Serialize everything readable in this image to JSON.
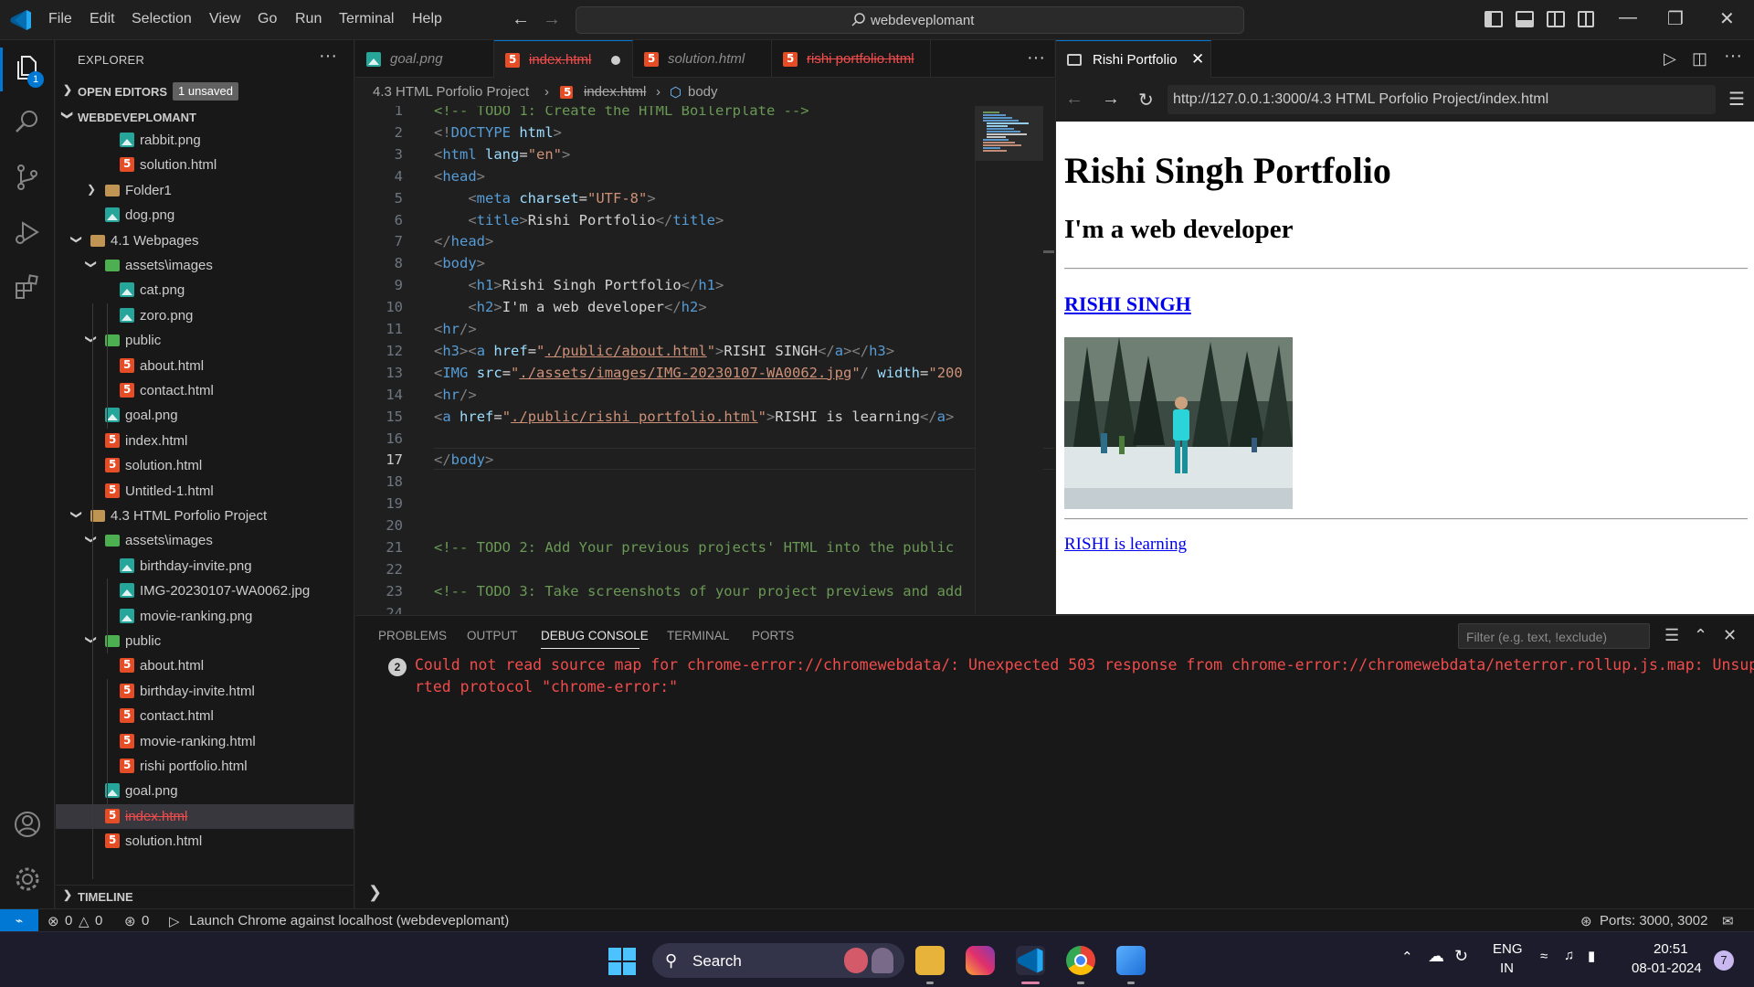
{
  "titlebar": {
    "menu": [
      "File",
      "Edit",
      "Selection",
      "View",
      "Go",
      "Run",
      "Terminal",
      "Help"
    ],
    "command_center": "webdeveplomant"
  },
  "activity_badge": "1",
  "sidebar": {
    "title": "EXPLORER",
    "open_editors": "OPEN EDITORS",
    "unsaved": "1 unsaved",
    "workspace": "WEBDEVEPLOMANT",
    "timeline": "TIMELINE",
    "tree": [
      {
        "name": "rabbit.png",
        "type": "img",
        "indent": 2
      },
      {
        "name": "solution.html",
        "type": "html",
        "indent": 2
      },
      {
        "name": "Folder1",
        "type": "folder",
        "indent": 1,
        "chevron": "right"
      },
      {
        "name": "dog.png",
        "type": "img",
        "indent": 1
      },
      {
        "name": "4.1 Webpages",
        "type": "folder",
        "indent": 0,
        "chevron": "down"
      },
      {
        "name": "assets\\images",
        "type": "folder-green",
        "indent": 1,
        "chevron": "down"
      },
      {
        "name": "cat.png",
        "type": "img",
        "indent": 2
      },
      {
        "name": "zoro.png",
        "type": "img",
        "indent": 2
      },
      {
        "name": "public",
        "type": "folder-green",
        "indent": 1,
        "chevron": "down"
      },
      {
        "name": "about.html",
        "type": "html",
        "indent": 2
      },
      {
        "name": "contact.html",
        "type": "html",
        "indent": 2
      },
      {
        "name": "goal.png",
        "type": "img",
        "indent": 1
      },
      {
        "name": "index.html",
        "type": "html",
        "indent": 1
      },
      {
        "name": "solution.html",
        "type": "html",
        "indent": 1
      },
      {
        "name": "Untitled-1.html",
        "type": "html",
        "indent": 1
      },
      {
        "name": "4.3 HTML Porfolio Project",
        "type": "folder",
        "indent": 0,
        "chevron": "down"
      },
      {
        "name": "assets\\images",
        "type": "folder-green",
        "indent": 1,
        "chevron": "down"
      },
      {
        "name": "birthday-invite.png",
        "type": "img",
        "indent": 2
      },
      {
        "name": "IMG-20230107-WA0062.jpg",
        "type": "img",
        "indent": 2
      },
      {
        "name": "movie-ranking.png",
        "type": "img",
        "indent": 2
      },
      {
        "name": "public",
        "type": "folder-green",
        "indent": 1,
        "chevron": "down"
      },
      {
        "name": "about.html",
        "type": "html",
        "indent": 2
      },
      {
        "name": "birthday-invite.html",
        "type": "html",
        "indent": 2
      },
      {
        "name": "contact.html",
        "type": "html",
        "indent": 2
      },
      {
        "name": "movie-ranking.html",
        "type": "html",
        "indent": 2
      },
      {
        "name": "rishi portfolio.html",
        "type": "html",
        "indent": 2
      },
      {
        "name": "goal.png",
        "type": "img",
        "indent": 1
      },
      {
        "name": "index.html",
        "type": "html",
        "indent": 1,
        "selected": true,
        "error": true
      },
      {
        "name": "solution.html",
        "type": "html",
        "indent": 1
      }
    ]
  },
  "editor": {
    "tabs": [
      {
        "label": "goal.png",
        "type": "img",
        "italic": true
      },
      {
        "label": "index.html",
        "type": "html",
        "active": true,
        "error": true,
        "dirty": true
      },
      {
        "label": "solution.html",
        "type": "html",
        "italic": true
      },
      {
        "label": "rishi portfolio.html",
        "type": "html",
        "error": true
      }
    ],
    "breadcrumb": {
      "folder": "4.3 HTML Porfolio Project",
      "file": "index.html",
      "symbol": "body"
    },
    "current_line": 17,
    "lines": [
      [
        [
          "c",
          "<!-- TODO 1: Create the HTML Boilerplate -->"
        ]
      ],
      [
        [
          "b",
          "<!"
        ],
        [
          "t",
          "DOCTYPE"
        ],
        [
          "s",
          " "
        ],
        [
          "a",
          "html"
        ],
        [
          "b",
          ">"
        ]
      ],
      [
        [
          "b",
          "<"
        ],
        [
          "t",
          "html"
        ],
        [
          "s",
          " "
        ],
        [
          "a",
          "lang"
        ],
        [
          "s",
          "="
        ],
        [
          "r",
          "\"en\""
        ],
        [
          "b",
          ">"
        ]
      ],
      [
        [
          "b",
          "<"
        ],
        [
          "t",
          "head"
        ],
        [
          "b",
          ">"
        ]
      ],
      [
        [
          "s",
          "    "
        ],
        [
          "b",
          "<"
        ],
        [
          "t",
          "meta"
        ],
        [
          "s",
          " "
        ],
        [
          "a",
          "charset"
        ],
        [
          "s",
          "="
        ],
        [
          "r",
          "\"UTF-8\""
        ],
        [
          "b",
          ">"
        ]
      ],
      [
        [
          "s",
          "    "
        ],
        [
          "b",
          "<"
        ],
        [
          "t",
          "title"
        ],
        [
          "b",
          ">"
        ],
        [
          "s",
          "Rishi Portfolio"
        ],
        [
          "b",
          "</"
        ],
        [
          "t",
          "title"
        ],
        [
          "b",
          ">"
        ]
      ],
      [
        [
          "b",
          "</"
        ],
        [
          "t",
          "head"
        ],
        [
          "b",
          ">"
        ]
      ],
      [
        [
          "b",
          "<"
        ],
        [
          "t",
          "body"
        ],
        [
          "b",
          ">"
        ]
      ],
      [
        [
          "s",
          "    "
        ],
        [
          "b",
          "<"
        ],
        [
          "t",
          "h1"
        ],
        [
          "b",
          ">"
        ],
        [
          "s",
          "Rishi Singh Portfolio"
        ],
        [
          "b",
          "</"
        ],
        [
          "t",
          "h1"
        ],
        [
          "b",
          ">"
        ]
      ],
      [
        [
          "s",
          "    "
        ],
        [
          "b",
          "<"
        ],
        [
          "t",
          "h2"
        ],
        [
          "b",
          ">"
        ],
        [
          "s",
          "I'm a web developer"
        ],
        [
          "b",
          "</"
        ],
        [
          "t",
          "h2"
        ],
        [
          "b",
          ">"
        ]
      ],
      [
        [
          "b",
          "<"
        ],
        [
          "t",
          "hr"
        ],
        [
          "b",
          "/>"
        ]
      ],
      [
        [
          "b",
          "<"
        ],
        [
          "t",
          "h3"
        ],
        [
          "b",
          "><"
        ],
        [
          "t",
          "a"
        ],
        [
          "s",
          " "
        ],
        [
          "a",
          "href"
        ],
        [
          "s",
          "="
        ],
        [
          "r",
          "\""
        ],
        [
          "u",
          "./public/about.html"
        ],
        [
          "r",
          "\""
        ],
        [
          "b",
          ">"
        ],
        [
          "s",
          "RISHI SINGH"
        ],
        [
          "b",
          "</"
        ],
        [
          "t",
          "a"
        ],
        [
          "b",
          "></"
        ],
        [
          "t",
          "h3"
        ],
        [
          "b",
          ">"
        ]
      ],
      [
        [
          "b",
          "<"
        ],
        [
          "t",
          "IMG"
        ],
        [
          "s",
          " "
        ],
        [
          "a",
          "src"
        ],
        [
          "s",
          "="
        ],
        [
          "r",
          "\""
        ],
        [
          "u",
          "./assets/images/IMG-20230107-WA0062.jpg"
        ],
        [
          "r",
          "\""
        ],
        [
          "b",
          "/"
        ],
        [
          "s",
          " "
        ],
        [
          "a",
          "width"
        ],
        [
          "s",
          "="
        ],
        [
          "r",
          "\"200"
        ]
      ],
      [
        [
          "b",
          "<"
        ],
        [
          "t",
          "hr"
        ],
        [
          "b",
          "/>"
        ]
      ],
      [
        [
          "b",
          "<"
        ],
        [
          "t",
          "a"
        ],
        [
          "s",
          " "
        ],
        [
          "a",
          "href"
        ],
        [
          "s",
          "="
        ],
        [
          "r",
          "\""
        ],
        [
          "u",
          "./public/rishi portfolio.html"
        ],
        [
          "r",
          "\""
        ],
        [
          "b",
          ">"
        ],
        [
          "s",
          "RISHI is learning"
        ],
        [
          "b",
          "</"
        ],
        [
          "t",
          "a"
        ],
        [
          "b",
          ">"
        ]
      ],
      [],
      [
        [
          "b",
          "</"
        ],
        [
          "t",
          "body"
        ],
        [
          "b",
          ">"
        ]
      ],
      [],
      [],
      [],
      [
        [
          "c",
          "<!-- TODO 2: Add Your previous projects' HTML into the public"
        ]
      ],
      [],
      [
        [
          "c",
          "<!-- TODO 3: Take screenshots of your project previews and add"
        ]
      ],
      []
    ]
  },
  "preview": {
    "tab_label": "Rishi Portfolio",
    "url": "http://127.0.0.1:3000/4.3 HTML Porfolio Project/index.html",
    "h1": "Rishi Singh Portfolio",
    "h2": "I'm a web developer",
    "h3_link": "RISHI SINGH",
    "link": "RISHI is learning"
  },
  "panel": {
    "tabs": [
      "PROBLEMS",
      "OUTPUT",
      "DEBUG CONSOLE",
      "TERMINAL",
      "PORTS"
    ],
    "active_tab": "DEBUG CONSOLE",
    "filter_placeholder": "Filter (e.g. text, !exclude)",
    "error_count": "2",
    "error_line1": "Could not read source map for chrome-error://chromewebdata/: Unexpected 503 response from chrome-error://chromewebdata/neterror.rollup.js.map: Unsuppo",
    "error_line2": "rted protocol \"chrome-error:\""
  },
  "statusbar": {
    "errors": "0",
    "warnings": "0",
    "broadcast": "0",
    "launch": "Launch Chrome against localhost (webdeveplomant)",
    "ports": "Ports: 3000, 3002"
  },
  "taskbar": {
    "search": "Search",
    "lang1": "ENG",
    "lang2": "IN",
    "time": "20:51",
    "date": "08-01-2024",
    "notif": "7"
  },
  "colors": {
    "accent": "#0078d4",
    "error": "#f14c4c",
    "html_icon": "#e44d26",
    "image_icon": "#26a69a"
  }
}
